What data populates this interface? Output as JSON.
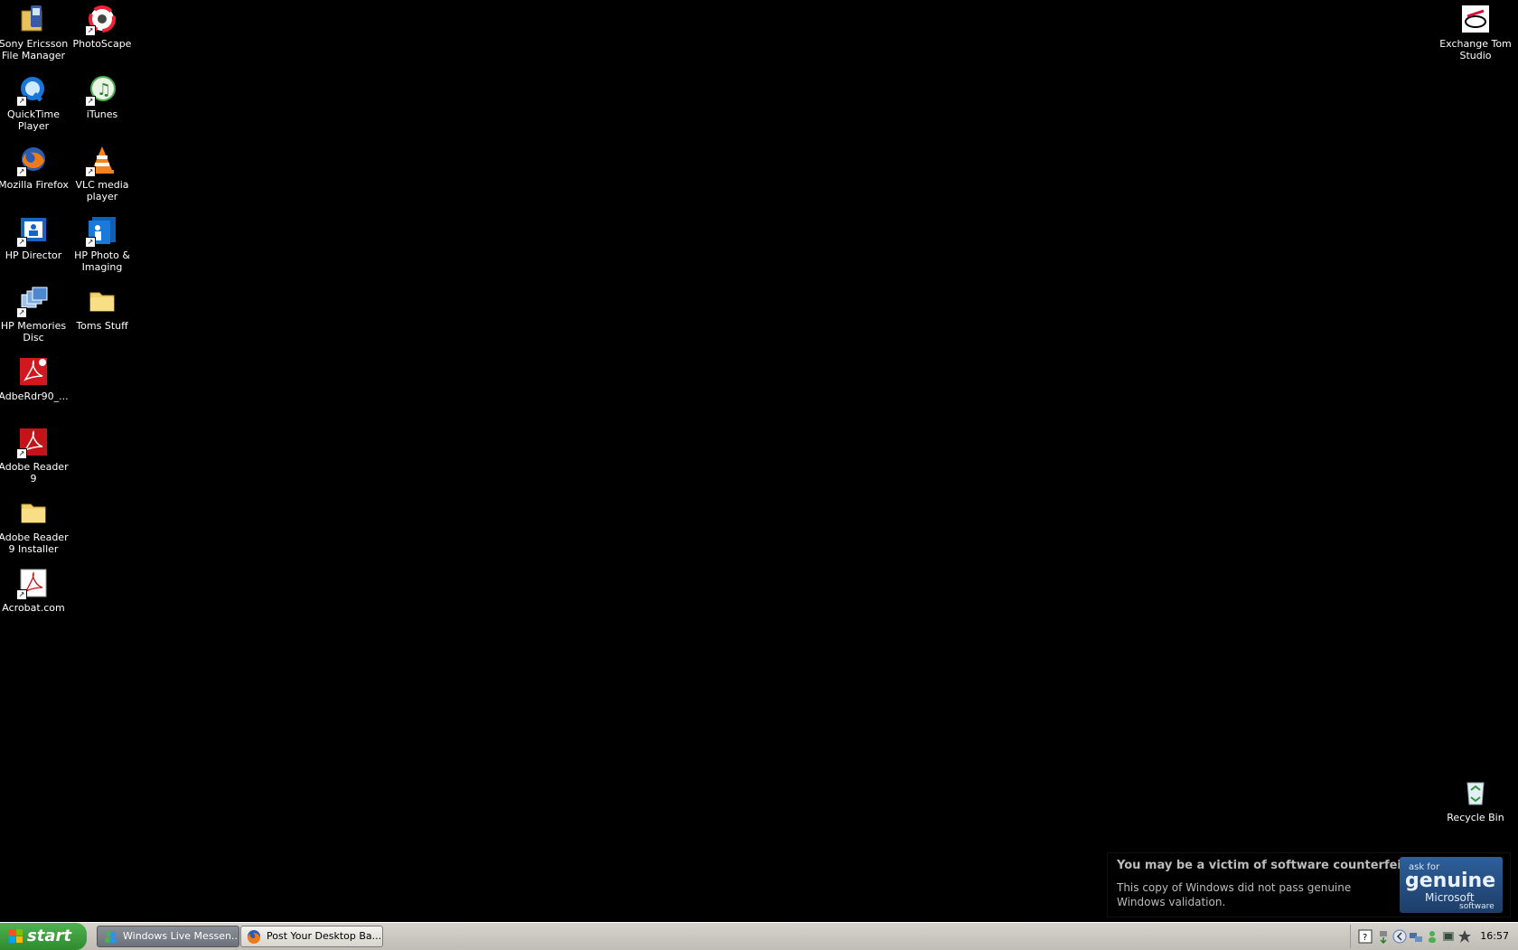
{
  "desktop": {
    "icons_left": [
      {
        "label": "Sony Ericsson File Manager",
        "icon": "sony-ericsson-icon"
      },
      {
        "label": "PhotoScape",
        "icon": "photoscape-icon"
      },
      {
        "label": "QuickTime Player",
        "icon": "quicktime-icon"
      },
      {
        "label": "iTunes",
        "icon": "itunes-icon"
      },
      {
        "label": "Mozilla Firefox",
        "icon": "firefox-icon"
      },
      {
        "label": "VLC media player",
        "icon": "vlc-icon"
      },
      {
        "label": "HP Director",
        "icon": "hp-director-icon"
      },
      {
        "label": "HP Photo & Imaging",
        "icon": "hp-photo-icon"
      },
      {
        "label": "HP Memories Disc",
        "icon": "hp-memories-icon"
      },
      {
        "label": "Toms Stuff",
        "icon": "folder-icon"
      },
      {
        "label": "AdbeRdr90_...",
        "icon": "adobe-installer-icon"
      },
      {
        "label": "Adobe Reader 9",
        "icon": "adobe-reader-icon"
      },
      {
        "label": "Adobe Reader 9 Installer",
        "icon": "folder-icon"
      },
      {
        "label": "Acrobat.com",
        "icon": "acrobat-com-icon"
      }
    ],
    "icon_exchange": {
      "label": "Exchange Tom Studio",
      "icon": "exchange-icon"
    },
    "icon_recycle": {
      "label": "Recycle Bin",
      "icon": "recycle-bin-icon"
    }
  },
  "taskbar": {
    "start_label": "start",
    "tasks": [
      {
        "label": "Windows Live Messen...",
        "icon": "messenger-icon",
        "active": true
      },
      {
        "label": "Post Your Desktop Ba...",
        "icon": "firefox-icon",
        "active": false
      }
    ],
    "clock": "16:57"
  },
  "balloon": {
    "title": "You may be a victim of software counterfeiting.",
    "body": "This copy of Windows did not pass genuine Windows validation.",
    "logo_ask": "ask for",
    "logo_genuine": "genuine",
    "logo_microsoft": "Microsoft",
    "logo_software": "software"
  }
}
